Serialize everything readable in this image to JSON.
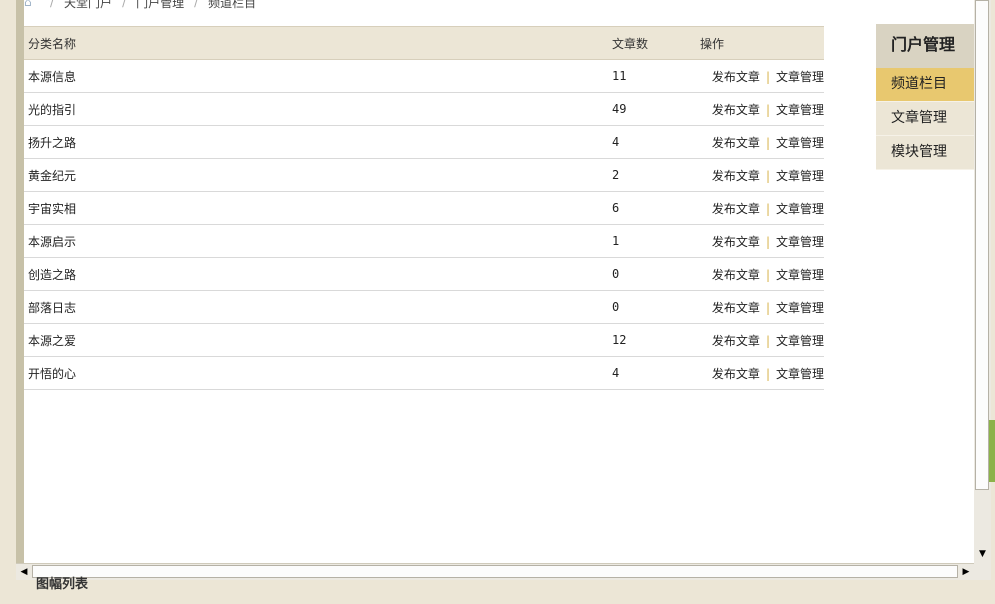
{
  "breadcrumb": {
    "items": [
      "天堂门户",
      "门户管理",
      "频道栏目"
    ],
    "separator": "/"
  },
  "table": {
    "headers": {
      "name": "分类名称",
      "count": "文章数",
      "ops": "操作"
    },
    "rows": [
      {
        "name": "本源信息",
        "count": "11",
        "publish": "发布文章",
        "manage": "文章管理"
      },
      {
        "name": "光的指引",
        "count": "49",
        "publish": "发布文章",
        "manage": "文章管理"
      },
      {
        "name": "扬升之路",
        "count": "4",
        "publish": "发布文章",
        "manage": "文章管理"
      },
      {
        "name": "黄金纪元",
        "count": "2",
        "publish": "发布文章",
        "manage": "文章管理"
      },
      {
        "name": "宇宙实相",
        "count": "6",
        "publish": "发布文章",
        "manage": "文章管理"
      },
      {
        "name": "本源启示",
        "count": "1",
        "publish": "发布文章",
        "manage": "文章管理"
      },
      {
        "name": "创造之路",
        "count": "0",
        "publish": "发布文章",
        "manage": "文章管理"
      },
      {
        "name": "部落日志",
        "count": "0",
        "publish": "发布文章",
        "manage": "文章管理"
      },
      {
        "name": "本源之爱",
        "count": "12",
        "publish": "发布文章",
        "manage": "文章管理"
      },
      {
        "name": "开悟的心",
        "count": "4",
        "publish": "发布文章",
        "manage": "文章管理"
      }
    ]
  },
  "sidebar": {
    "title": "门户管理",
    "items": [
      {
        "label": "频道栏目",
        "active": true
      },
      {
        "label": "文章管理",
        "active": false
      },
      {
        "label": "模块管理",
        "active": false
      }
    ]
  },
  "below": {
    "title": "图幅列表"
  },
  "scrollbars": {
    "up_arrow": "▲",
    "down_arrow": "▼",
    "left_arrow": "◀",
    "right_arrow": "▶"
  },
  "colors": {
    "accent": "#e8c86f",
    "header_bg": "#ece6d6",
    "pipe": "#d8b34a"
  }
}
